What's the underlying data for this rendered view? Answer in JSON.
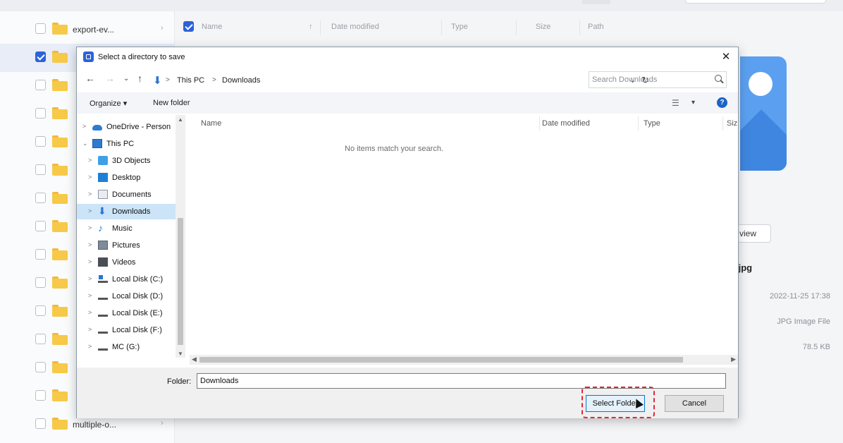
{
  "background_app": {
    "file_list": [
      {
        "name": "export-ev...",
        "checked": false,
        "chevron": "›"
      },
      {
        "name": "",
        "checked": true,
        "chevron": ""
      },
      {
        "name": "",
        "checked": false,
        "chevron": ""
      },
      {
        "name": "",
        "checked": false,
        "chevron": ""
      },
      {
        "name": "",
        "checked": false,
        "chevron": ""
      },
      {
        "name": "",
        "checked": false,
        "chevron": ""
      },
      {
        "name": "",
        "checked": false,
        "chevron": ""
      },
      {
        "name": "",
        "checked": false,
        "chevron": ""
      },
      {
        "name": "",
        "checked": false,
        "chevron": ""
      },
      {
        "name": "",
        "checked": false,
        "chevron": ""
      },
      {
        "name": "",
        "checked": false,
        "chevron": ""
      },
      {
        "name": "",
        "checked": false,
        "chevron": ""
      },
      {
        "name": "",
        "checked": false,
        "chevron": ""
      },
      {
        "name": "",
        "checked": false,
        "chevron": ""
      },
      {
        "name": "multiple-o...",
        "checked": false,
        "chevron": "›"
      }
    ],
    "columns": {
      "name": "Name",
      "sort_arrow": "↑",
      "date_modified": "Date modified",
      "type": "Type",
      "size": "Size",
      "path": "Path"
    },
    "preview": {
      "button_label": "view",
      "file_name": ".jpg",
      "date": "2022-11-25 17:38",
      "type": "JPG Image File",
      "size": "78.5 KB"
    }
  },
  "dialog": {
    "title": "Select a directory to save",
    "close_glyph": "✕",
    "nav": {
      "back": "←",
      "forward": "→",
      "recent": "⌄",
      "up": "↑"
    },
    "breadcrumb": [
      "This PC",
      "Downloads"
    ],
    "breadcrumb_sep": ">",
    "search_placeholder": "Search Downloads",
    "toolbar": {
      "organize": "Organize ▾",
      "new_folder": "New folder"
    },
    "tree": [
      {
        "label": "OneDrive - Person",
        "icon": "cloud-icon",
        "indent": 0,
        "arrow": ">",
        "selected": false
      },
      {
        "label": "This PC",
        "icon": "computer-icon",
        "indent": 0,
        "arrow": "⌄",
        "selected": false
      },
      {
        "label": "3D Objects",
        "icon": "3d-objects-icon",
        "indent": 1,
        "arrow": ">",
        "selected": false
      },
      {
        "label": "Desktop",
        "icon": "desktop-icon",
        "indent": 1,
        "arrow": ">",
        "selected": false
      },
      {
        "label": "Documents",
        "icon": "documents-icon",
        "indent": 1,
        "arrow": ">",
        "selected": false
      },
      {
        "label": "Downloads",
        "icon": "downloads-icon",
        "indent": 1,
        "arrow": ">",
        "selected": true
      },
      {
        "label": "Music",
        "icon": "music-icon",
        "indent": 1,
        "arrow": ">",
        "selected": false
      },
      {
        "label": "Pictures",
        "icon": "pictures-icon",
        "indent": 1,
        "arrow": ">",
        "selected": false
      },
      {
        "label": "Videos",
        "icon": "videos-icon",
        "indent": 1,
        "arrow": ">",
        "selected": false
      },
      {
        "label": "Local Disk (C:)",
        "icon": "local-disk-c-icon",
        "indent": 1,
        "arrow": ">",
        "selected": false
      },
      {
        "label": "Local Disk (D:)",
        "icon": "local-disk-icon",
        "indent": 1,
        "arrow": ">",
        "selected": false
      },
      {
        "label": "Local Disk (E:)",
        "icon": "local-disk-icon",
        "indent": 1,
        "arrow": ">",
        "selected": false
      },
      {
        "label": "Local Disk (F:)",
        "icon": "local-disk-icon",
        "indent": 1,
        "arrow": ">",
        "selected": false
      },
      {
        "label": "MC (G:)",
        "icon": "network-drive-icon",
        "indent": 1,
        "arrow": ">",
        "selected": false
      }
    ],
    "file_columns": {
      "name": "Name",
      "date_modified": "Date modified",
      "type": "Type",
      "size": "Siz"
    },
    "empty_message": "No items match your search.",
    "folder_label": "Folder:",
    "folder_value": "Downloads",
    "select_button": "Select Folder",
    "cancel_button": "Cancel"
  },
  "colors": {
    "accent": "#2d62d8",
    "selection": "#cce4f7",
    "highlight": "#e0283a"
  }
}
